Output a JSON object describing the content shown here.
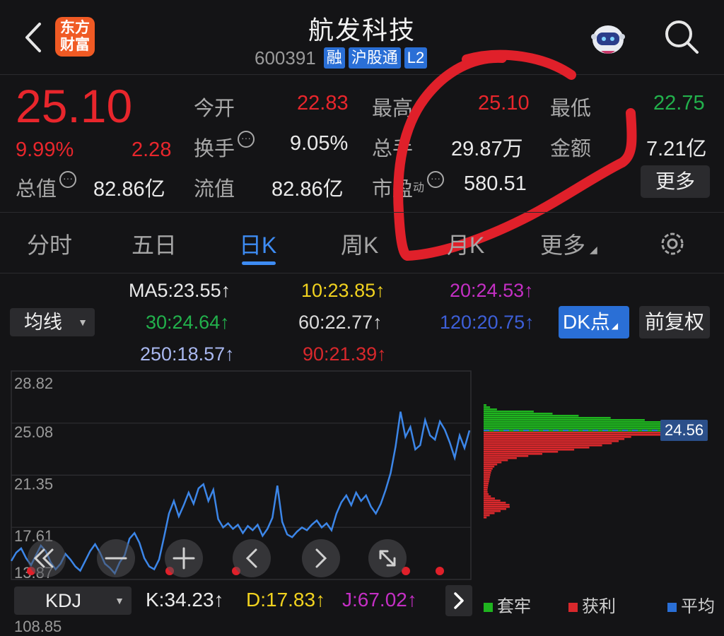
{
  "header": {
    "title": "航发科技",
    "logo_line1": "东方",
    "logo_line2": "财富",
    "code": "600391",
    "tags": [
      "融",
      "沪股通",
      "L2"
    ]
  },
  "quote": {
    "price": "25.10",
    "change_pct": "9.99%",
    "change": "2.28",
    "total_value_label": "总值",
    "total_value": "82.86亿",
    "open_label": "今开",
    "open": "22.83",
    "turnover_label": "换手",
    "turnover": "9.05%",
    "float_label": "流值",
    "float_value": "82.86亿",
    "high_label": "最高",
    "high": "25.10",
    "total_hand_label": "总手",
    "total_hand": "29.87万",
    "pe_label": "市盈",
    "pe_sup": "动",
    "pe": "580.51",
    "low_label": "最低",
    "low": "22.75",
    "amount_label": "金额",
    "amount": "7.21亿",
    "more": "更多",
    "info_glyph": "···"
  },
  "tabs": [
    "分时",
    "五日",
    "日K",
    "周K",
    "月K",
    "更多"
  ],
  "ma": {
    "selector": "均线",
    "ma5": "MA5:23.55↑",
    "ma10": "10:23.85↑",
    "ma20": "20:24.53↑",
    "ma30": "30:24.64↑",
    "ma60": "60:22.77↑",
    "ma120": "120:20.75↑",
    "ma250": "250:18.57↑",
    "ma90": "90:21.39↑",
    "dk": "DK点",
    "restore": "前复权"
  },
  "chart_data": {
    "type": "line",
    "yticks": [
      "28.82",
      "25.08",
      "21.35",
      "17.61",
      "13.87"
    ],
    "ylim": [
      13.87,
      28.82
    ],
    "price_label": "24.56",
    "values": [
      15.2,
      15.8,
      16.1,
      15.4,
      14.9,
      15.6,
      16.3,
      15.9,
      15.1,
      14.6,
      15.0,
      15.7,
      15.3,
      14.8,
      14.5,
      15.2,
      15.9,
      16.4,
      15.8,
      15.0,
      14.7,
      14.3,
      15.1,
      15.6,
      16.8,
      17.2,
      16.5,
      15.4,
      14.8,
      14.6,
      15.3,
      16.9,
      18.6,
      19.5,
      18.4,
      19.2,
      20.1,
      19.3,
      20.4,
      20.7,
      19.5,
      20.3,
      18.2,
      17.6,
      17.9,
      17.5,
      17.8,
      17.2,
      17.7,
      17.4,
      17.8,
      17.0,
      17.5,
      18.3,
      20.6,
      18.0,
      17.1,
      16.9,
      17.3,
      17.6,
      17.4,
      17.8,
      18.1,
      17.6,
      17.9,
      17.4,
      18.6,
      19.4,
      19.9,
      19.2,
      20.1,
      19.5,
      19.9,
      19.1,
      18.6,
      19.3,
      20.3,
      21.5,
      23.4,
      25.9,
      24.1,
      24.8,
      23.2,
      23.5,
      25.3,
      24.2,
      23.9,
      25.2,
      24.6,
      23.7,
      22.6,
      24.2,
      23.3,
      24.56
    ],
    "legend": [
      "套牢",
      "获利",
      "平均"
    ],
    "legend_colors": [
      "#1fb41f",
      "#d8282c",
      "#2a6fd6"
    ],
    "line_color": "#3c86e8"
  },
  "kdj": {
    "selector": "KDJ",
    "k": "K:34.23↑",
    "d": "D:17.83↑",
    "j": "J:67.02↑",
    "bottom_tick": "108.85"
  },
  "colors": {
    "up": "#e8262c",
    "down": "#22b14c",
    "accent": "#3e8cf3"
  }
}
